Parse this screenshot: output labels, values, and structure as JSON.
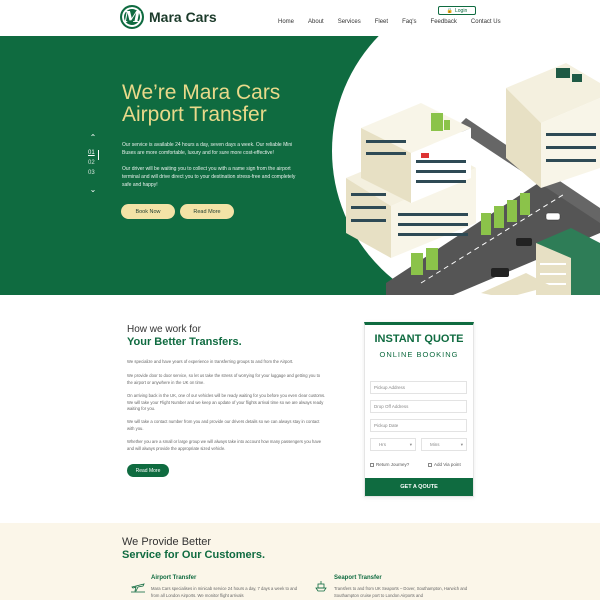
{
  "header": {
    "logo_letter": "M",
    "logo_text": "Mara Cars",
    "login_label": "Login",
    "nav": [
      "Home",
      "About",
      "Services",
      "Fleet",
      "Faq's",
      "Feedback",
      "Contact Us"
    ]
  },
  "hero": {
    "title_line1": "We’re Mara Cars",
    "title_line2": "Airport Transfer",
    "paragraph1": "Our service is available 24 hours a day, seven days a week. Our reliable Mini Buses are more comfortable, luxury and for sure more cost-effective!",
    "paragraph2": "Our driver will be waiting you to collect you with a name sign from the airport terminal and will drive direct you to your destination stress-free and completely safe and happy!",
    "slides": [
      "01",
      "02",
      "03"
    ],
    "active_slide": "01",
    "book_now": "Book Now",
    "read_more": "Read More"
  },
  "how": {
    "title": "How we work for",
    "subtitle": "Your Better Transfers.",
    "paragraphs": [
      "We specialize and have years of experience in transferring groups to and from the Airport.",
      "We provide door to door service, so let us take the stress of worrying for your luggage and getting you to the airport or anywhere in the UK on time.",
      "On arriving back in the UK, one of our vehicles will be ready waiting for you before you even clear customs. We will take your Flight Number and we keep an update of your flights arrival time so we are always ready waiting for you.",
      "We will take a contact number from you and provide our drivers details so we can always stay in contact with you.",
      "Whether you are a small or large group we will always take into account how many passengers you have and will always provide the appropriate sized vehicle."
    ],
    "read_more": "Read More"
  },
  "quote": {
    "title": "INSTANT QUOTE",
    "subtitle": "ONLINE BOOKING",
    "pickup_placeholder": "Pickup Address",
    "dropoff_placeholder": "Drop Off Address",
    "date_placeholder": "Pickup Date",
    "hrs": "Hrs",
    "mins": "Mins",
    "return_label": "Return Journey?",
    "via_label": "Add Via point",
    "button": "GET A QOUTE"
  },
  "services": {
    "title": "We Provide Better",
    "subtitle": "Service for Our Customers.",
    "items": [
      {
        "name": "Airport Transfer",
        "desc": "Mara Cars specialises in minicab service 24 hours a day, 7 days a week to and from all London Airports. We monitor flight arrivals",
        "icon": "plane-icon"
      },
      {
        "name": "Seaport Transfer",
        "desc": "Transfers to and from UK Seaports – Dover, Southampton, Harwich and Southampton cruise port to London Airports and",
        "icon": "ship-icon"
      }
    ]
  },
  "colors": {
    "brand_green": "#0f6b40",
    "hero_title": "#e9d98a",
    "button_cream": "#f3e3a6",
    "services_bg": "#fbf6e9"
  }
}
